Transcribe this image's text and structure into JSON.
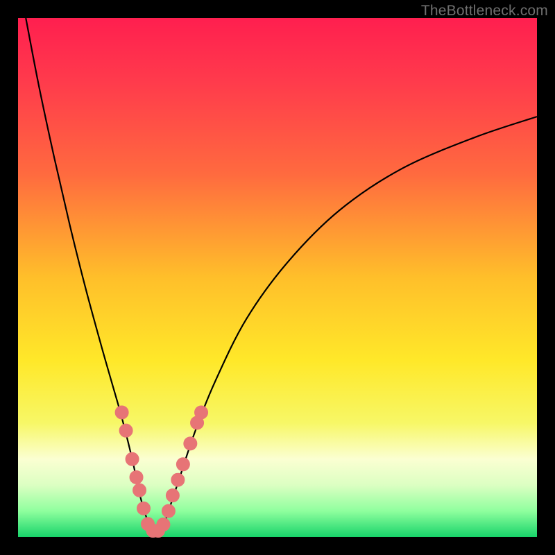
{
  "watermark": "TheBottleneck.com",
  "colors": {
    "frame": "#000000",
    "gradient_stops": [
      {
        "offset": 0.0,
        "color": "#ff1f4f"
      },
      {
        "offset": 0.12,
        "color": "#ff3a4c"
      },
      {
        "offset": 0.3,
        "color": "#ff6a3f"
      },
      {
        "offset": 0.5,
        "color": "#ffbf2a"
      },
      {
        "offset": 0.66,
        "color": "#ffe829"
      },
      {
        "offset": 0.78,
        "color": "#f7f766"
      },
      {
        "offset": 0.85,
        "color": "#fbffd2"
      },
      {
        "offset": 0.9,
        "color": "#dcffc2"
      },
      {
        "offset": 0.95,
        "color": "#8fff9e"
      },
      {
        "offset": 1.0,
        "color": "#18d46a"
      }
    ],
    "curve": "#000000",
    "marker_fill": "#e77476",
    "marker_stroke": "#e77476"
  },
  "chart_data": {
    "type": "line",
    "title": "",
    "xlabel": "",
    "ylabel": "",
    "xlim": [
      0,
      100
    ],
    "ylim": [
      0,
      100
    ],
    "grid": false,
    "legend": false,
    "series": [
      {
        "name": "bottleneck-curve",
        "x": [
          1.5,
          4,
          7,
          10,
          13,
          16,
          18,
          20,
          22,
          23.5,
          25,
          26,
          27,
          28,
          29,
          31,
          34,
          38,
          44,
          52,
          62,
          74,
          88,
          100
        ],
        "y": [
          100,
          87,
          73,
          60,
          48,
          37,
          30,
          23,
          15,
          8,
          3,
          1,
          1,
          2,
          5,
          11,
          20,
          30,
          42,
          53,
          63,
          71,
          77,
          81
        ]
      }
    ],
    "markers": {
      "name": "highlighted-points",
      "points": [
        {
          "x": 20.0,
          "y": 24.0
        },
        {
          "x": 20.8,
          "y": 20.5
        },
        {
          "x": 22.0,
          "y": 15.0
        },
        {
          "x": 22.8,
          "y": 11.5
        },
        {
          "x": 23.4,
          "y": 9.0
        },
        {
          "x": 24.2,
          "y": 5.5
        },
        {
          "x": 25.0,
          "y": 2.5
        },
        {
          "x": 26.0,
          "y": 1.2
        },
        {
          "x": 27.0,
          "y": 1.2
        },
        {
          "x": 28.0,
          "y": 2.4
        },
        {
          "x": 29.0,
          "y": 5.0
        },
        {
          "x": 29.8,
          "y": 8.0
        },
        {
          "x": 30.8,
          "y": 11.0
        },
        {
          "x": 31.8,
          "y": 14.0
        },
        {
          "x": 33.2,
          "y": 18.0
        },
        {
          "x": 34.5,
          "y": 22.0
        },
        {
          "x": 35.3,
          "y": 24.0
        }
      ]
    }
  }
}
